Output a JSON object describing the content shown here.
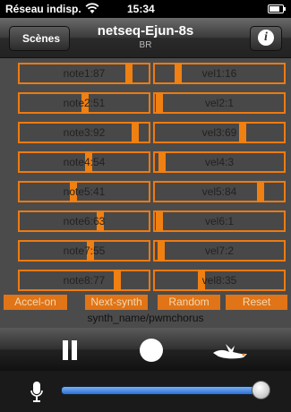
{
  "status_bar": {
    "carrier": "Réseau indisp.",
    "time": "15:34"
  },
  "nav": {
    "back_label": "Scènes",
    "title": "netseq-Ejun-8s",
    "subtitle": "BR",
    "info_glyph": "i"
  },
  "note_sliders": [
    {
      "label": "note1:87",
      "value": 87
    },
    {
      "label": "note2:51",
      "value": 51
    },
    {
      "label": "note3:92",
      "value": 92
    },
    {
      "label": "note4:54",
      "value": 54
    },
    {
      "label": "note5:41",
      "value": 41
    },
    {
      "label": "note6:63",
      "value": 63
    },
    {
      "label": "note7:55",
      "value": 55
    },
    {
      "label": "note8:77",
      "value": 77
    }
  ],
  "vel_sliders": [
    {
      "label": "vel1:16",
      "value": 16
    },
    {
      "label": "vel2:1",
      "value": 1
    },
    {
      "label": "vel3:69",
      "value": 69
    },
    {
      "label": "vel4:3",
      "value": 3
    },
    {
      "label": "vel5:84",
      "value": 84
    },
    {
      "label": "vel6:1",
      "value": 1
    },
    {
      "label": "vel7:2",
      "value": 2
    },
    {
      "label": "vel8:35",
      "value": 35
    }
  ],
  "buttons": {
    "accel": "Accel-on",
    "next_synth": "Next-synth",
    "random": "Random",
    "reset": "Reset"
  },
  "synth_name": "synth_name/pwmchorus",
  "transport": {
    "pause_icon": "pause-icon",
    "record_icon": "record-icon",
    "bird_icon": "bird-icon"
  },
  "volume": {
    "level": 1.0
  },
  "colors": {
    "accent": "#f08012",
    "slider_bg": "#484848",
    "panel_bg": "#4b4b4b"
  }
}
